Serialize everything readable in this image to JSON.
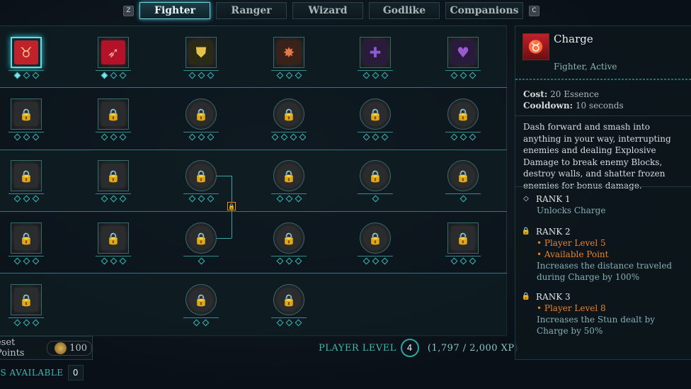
{
  "tabs": {
    "prev_key": "Z",
    "next_key": "C",
    "items": [
      {
        "label": "Fighter",
        "active": true
      },
      {
        "label": "Ranger",
        "active": false
      },
      {
        "label": "Wizard",
        "active": false
      },
      {
        "label": "Godlike",
        "active": false
      },
      {
        "label": "Companions",
        "active": false
      }
    ]
  },
  "grid": {
    "rows": [
      [
        {
          "icon": "charge-icon",
          "selected": true,
          "ranks": 3,
          "filled": 1
        },
        {
          "icon": "red-skill-icon",
          "ranks": 3,
          "filled": 1
        },
        {
          "icon": "gold-shield-icon",
          "ranks": 3
        },
        {
          "icon": "burst-shield-icon",
          "ranks": 3
        },
        {
          "icon": "purple-cross-icon",
          "ranks": 3
        },
        {
          "icon": "purple-heart-icon",
          "ranks": 3
        }
      ],
      [
        {
          "icon": "locked-icon",
          "ranks": 3
        },
        {
          "icon": "locked-icon",
          "ranks": 3
        },
        {
          "icon": "locked-icon",
          "ranks": 3
        },
        {
          "icon": "locked-icon",
          "ranks": 4
        },
        {
          "icon": "locked-icon",
          "ranks": 3
        },
        {
          "icon": "locked-icon",
          "ranks": 3
        }
      ],
      [
        {
          "icon": "locked-icon",
          "ranks": 3
        },
        {
          "icon": "locked-icon",
          "ranks": 3
        },
        {
          "icon": "locked-icon",
          "ranks": 3
        },
        {
          "icon": "locked-icon",
          "ranks": 3
        },
        {
          "icon": "locked-icon",
          "ranks": 1
        },
        {
          "icon": "locked-icon",
          "ranks": 1
        }
      ],
      [
        {
          "icon": "locked-icon",
          "ranks": 3
        },
        {
          "icon": "locked-icon",
          "ranks": 3
        },
        {
          "icon": "locked-icon",
          "ranks": 1
        },
        {
          "icon": "locked-icon",
          "ranks": 3
        },
        {
          "icon": "locked-icon",
          "ranks": 3
        },
        {
          "icon": "locked-icon",
          "ranks": 3
        }
      ],
      [
        {
          "icon": "locked-icon",
          "ranks": 3
        },
        null,
        {
          "icon": "locked-icon",
          "ranks": 2
        },
        {
          "icon": "locked-icon",
          "ranks": 3
        },
        null,
        null
      ]
    ]
  },
  "bottom": {
    "reset_label": "eset Points",
    "reset_cost": "100",
    "player_level_label": "PLAYER LEVEL",
    "player_level": "4",
    "xp": "(1,797 / 2,000 XP)",
    "points_label": "TS AVAILABLE",
    "points_value": "0"
  },
  "detail": {
    "title": "Charge",
    "subtitle": "Fighter, Active",
    "cost_label": "Cost:",
    "cost_value": "20 Essence",
    "cooldown_label": "Cooldown:",
    "cooldown_value": "10 seconds",
    "description": "Dash forward and smash into anything in your way, interrupting enemies and dealing Explosive Damage to break enemy Blocks, destroy walls, and shatter frozen enemies for bonus damage.",
    "ranks": [
      {
        "title": "RANK 1",
        "locked": false,
        "reqs": [],
        "text": "Unlocks Charge"
      },
      {
        "title": "RANK 2",
        "locked": true,
        "reqs": [
          "• Player Level 5",
          "• Available Point"
        ],
        "text": "Increases the distance traveled during Charge by 100%"
      },
      {
        "title": "RANK 3",
        "locked": true,
        "reqs": [
          "• Player Level 8"
        ],
        "text": "Increases the Stun dealt by Charge by 50%"
      }
    ]
  },
  "colors": {
    "accent": "#3fb7b3",
    "lock": "#e8912e",
    "selected": "#5fe0e6"
  }
}
